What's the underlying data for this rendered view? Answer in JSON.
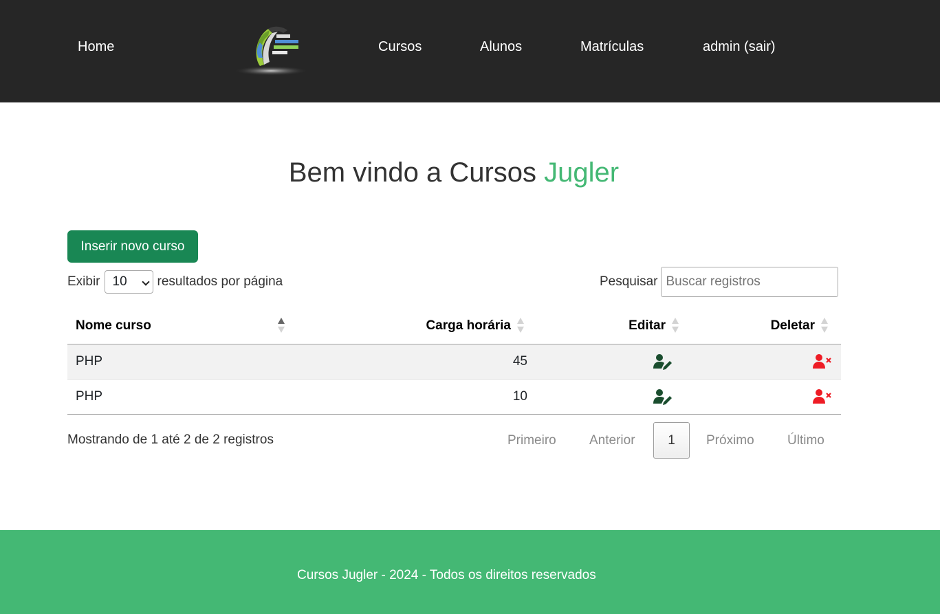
{
  "nav": {
    "home": "Home",
    "cursos": "Cursos",
    "alunos": "Alunos",
    "matriculas": "Matrículas",
    "admin": "admin (sair)"
  },
  "hero": {
    "title_prefix": "Bem vindo a Cursos ",
    "title_brand": "Jugler"
  },
  "toolbar": {
    "insert_label": "Inserir novo curso"
  },
  "length": {
    "prefix": "Exibir",
    "value": "10",
    "suffix": "resultados por página"
  },
  "search": {
    "label": "Pesquisar",
    "placeholder": "Buscar registros"
  },
  "table": {
    "headers": {
      "name": "Nome curso",
      "carga": "Carga horária",
      "editar": "Editar",
      "deletar": "Deletar"
    },
    "rows": [
      {
        "name": "PHP",
        "carga": "45",
        "edit_icon": "user-edit-icon",
        "delete_icon": "user-delete-icon"
      },
      {
        "name": "PHP",
        "carga": "10",
        "edit_icon": "user-edit-icon",
        "delete_icon": "user-delete-icon"
      }
    ]
  },
  "info": "Mostrando de 1 até 2 de 2 registros",
  "pagination": {
    "first": "Primeiro",
    "prev": "Anterior",
    "current": "1",
    "next": "Próximo",
    "last": "Último"
  },
  "footer": {
    "text": "Cursos Jugler - 2024 - Todos os direitos reservados"
  },
  "colors": {
    "navbar": "#262626",
    "brand_green": "#44b874",
    "button_green": "#198754",
    "edit_icon": "#1a4d2e",
    "delete_icon": "#ee1c25"
  }
}
